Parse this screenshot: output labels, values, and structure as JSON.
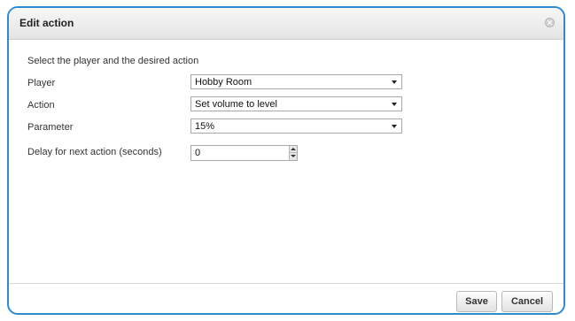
{
  "dialog": {
    "title": "Edit action",
    "instruction": "Select the player and the desired action"
  },
  "fields": {
    "player": {
      "label": "Player",
      "value": "Hobby Room"
    },
    "action": {
      "label": "Action",
      "value": "Set volume to level"
    },
    "parameter": {
      "label": "Parameter",
      "value": "15%"
    },
    "delay": {
      "label": "Delay for next action (seconds)",
      "value": "0"
    }
  },
  "buttons": {
    "save": "Save",
    "cancel": "Cancel"
  },
  "colors": {
    "dialog_border": "#2f8bd0"
  }
}
